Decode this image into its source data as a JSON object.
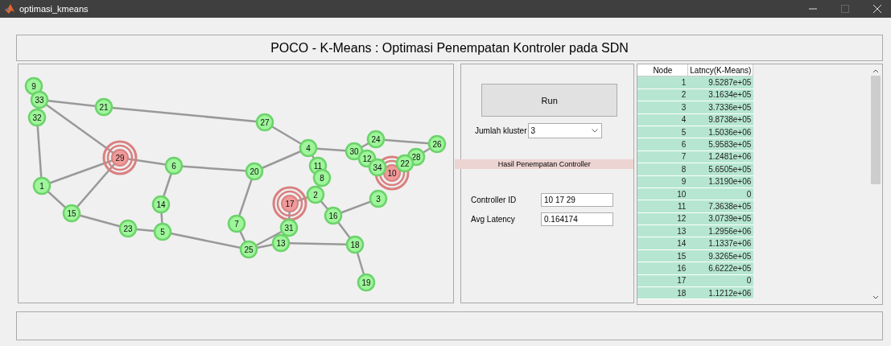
{
  "window": {
    "title": "optimasi_kmeans"
  },
  "header": {
    "title": "POCO - K-Means : Optimasi Penempatan Kontroler pada SDN"
  },
  "graph": {
    "nodes": [
      {
        "label": "9",
        "controller": false
      },
      {
        "label": "33",
        "controller": false
      },
      {
        "label": "32",
        "controller": false
      },
      {
        "label": "21",
        "controller": false
      },
      {
        "label": "29",
        "controller": true
      },
      {
        "label": "6",
        "controller": false
      },
      {
        "label": "1",
        "controller": false
      },
      {
        "label": "15",
        "controller": false
      },
      {
        "label": "14",
        "controller": false
      },
      {
        "label": "23",
        "controller": false
      },
      {
        "label": "5",
        "controller": false
      },
      {
        "label": "7",
        "controller": false
      },
      {
        "label": "27",
        "controller": false
      },
      {
        "label": "4",
        "controller": false
      },
      {
        "label": "20",
        "controller": false
      },
      {
        "label": "11",
        "controller": false
      },
      {
        "label": "8",
        "controller": false
      },
      {
        "label": "2",
        "controller": false
      },
      {
        "label": "17",
        "controller": true
      },
      {
        "label": "31",
        "controller": false
      },
      {
        "label": "13",
        "controller": false
      },
      {
        "label": "25",
        "controller": false
      },
      {
        "label": "16",
        "controller": false
      },
      {
        "label": "18",
        "controller": false
      },
      {
        "label": "19",
        "controller": false
      },
      {
        "label": "3",
        "controller": false
      },
      {
        "label": "30",
        "controller": false
      },
      {
        "label": "24",
        "controller": false
      },
      {
        "label": "26",
        "controller": false
      },
      {
        "label": "28",
        "controller": false
      },
      {
        "label": "22",
        "controller": false
      },
      {
        "label": "12",
        "controller": false
      },
      {
        "label": "34",
        "controller": false
      },
      {
        "label": "10",
        "controller": true
      }
    ]
  },
  "controls": {
    "run_button": "Run",
    "cluster_label": "Jumlah kluster",
    "cluster_value": "3",
    "result_heading": "Hasil Penempatan Controller",
    "fields": [
      {
        "label": "Controller ID",
        "value": "10  17  29"
      },
      {
        "label": "Avg Latency",
        "value": "0.164174"
      }
    ]
  },
  "table": {
    "columns": [
      "Node",
      "Latncy(K-Means)"
    ],
    "rows": [
      [
        "1",
        "9.5287e+05"
      ],
      [
        "2",
        "3.1634e+05"
      ],
      [
        "3",
        "3.7336e+05"
      ],
      [
        "4",
        "9.8738e+05"
      ],
      [
        "5",
        "1.5036e+06"
      ],
      [
        "6",
        "5.9583e+05"
      ],
      [
        "7",
        "1.2481e+06"
      ],
      [
        "8",
        "5.6505e+05"
      ],
      [
        "9",
        "1.3190e+06"
      ],
      [
        "10",
        "0"
      ],
      [
        "11",
        "7.3638e+05"
      ],
      [
        "12",
        "3.0739e+05"
      ],
      [
        "13",
        "1.2956e+06"
      ],
      [
        "14",
        "1.1337e+06"
      ],
      [
        "15",
        "9.3265e+05"
      ],
      [
        "16",
        "6.6222e+05"
      ],
      [
        "17",
        "0"
      ],
      [
        "18",
        "1.1212e+06"
      ]
    ]
  }
}
